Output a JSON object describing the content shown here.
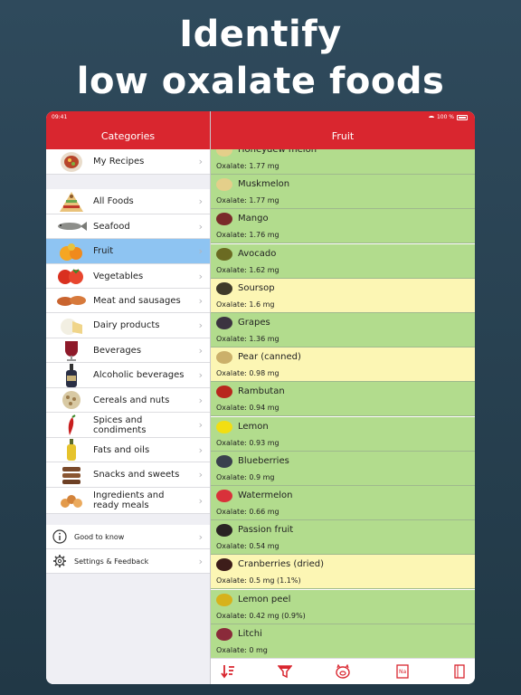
{
  "headline": {
    "line1": "Identify",
    "line2": "low oxalate foods"
  },
  "status_bar": {
    "time": "09:41",
    "battery": "100 %"
  },
  "left_header": {
    "title": "Categories"
  },
  "right_header": {
    "title": "Fruit"
  },
  "categories": [
    {
      "label": "My Recipes",
      "icon": "recipe-bowl-icon"
    },
    {
      "label": "All Foods",
      "icon": "food-pyramid-icon"
    },
    {
      "label": "Seafood",
      "icon": "fish-icon"
    },
    {
      "label": "Fruit",
      "icon": "fruit-icon",
      "selected": true
    },
    {
      "label": "Vegetables",
      "icon": "tomato-icon"
    },
    {
      "label": "Meat and sausages",
      "icon": "sausage-icon"
    },
    {
      "label": "Dairy products",
      "icon": "cheese-icon"
    },
    {
      "label": "Beverages",
      "icon": "wine-glass-icon"
    },
    {
      "label": "Alcoholic beverages",
      "icon": "bottle-icon"
    },
    {
      "label": "Cereals and nuts",
      "icon": "grain-icon"
    },
    {
      "label": "Spices and condiments",
      "icon": "chili-icon"
    },
    {
      "label": "Fats and oils",
      "icon": "oil-bottle-icon"
    },
    {
      "label": "Snacks and sweets",
      "icon": "cookie-icon"
    },
    {
      "label": "Ingredients and ready meals",
      "label_line1": "Ingredients and",
      "label_line2": "ready meals",
      "icon": "ingredients-icon"
    }
  ],
  "extras": [
    {
      "label": "Good to know",
      "icon": "info-icon"
    },
    {
      "label": "Settings & Feedback",
      "icon": "gear-icon"
    }
  ],
  "foods": [
    {
      "name": "Honeydew melon",
      "oxalate": "Oxalate: 1.77 mg",
      "color": "green",
      "icon": "melon-icon"
    },
    {
      "name": "Muskmelon",
      "oxalate": "Oxalate: 1.77 mg",
      "color": "green",
      "icon": "melon-icon"
    },
    {
      "name": "Mango",
      "oxalate": "Oxalate: 1.76 mg",
      "color": "green",
      "icon": "mango-icon"
    },
    {
      "name": "Avocado",
      "oxalate": "Oxalate: 1.62 mg",
      "color": "green",
      "icon": "avocado-icon"
    },
    {
      "name": "Soursop",
      "oxalate": "Oxalate: 1.6 mg",
      "color": "yellow",
      "icon": "soursop-icon"
    },
    {
      "name": "Grapes",
      "oxalate": "Oxalate: 1.36 mg",
      "color": "green",
      "icon": "grapes-icon"
    },
    {
      "name": "Pear (canned)",
      "oxalate": "Oxalate: 0.98 mg",
      "color": "yellow",
      "icon": "pear-icon"
    },
    {
      "name": "Rambutan",
      "oxalate": "Oxalate: 0.94 mg",
      "color": "green",
      "icon": "rambutan-icon"
    },
    {
      "name": "Lemon",
      "oxalate": "Oxalate: 0.93 mg",
      "color": "green",
      "icon": "lemon-icon"
    },
    {
      "name": "Blueberries",
      "oxalate": "Oxalate: 0.9 mg",
      "color": "green",
      "icon": "blueberries-icon"
    },
    {
      "name": "Watermelon",
      "oxalate": "Oxalate: 0.66 mg",
      "color": "green",
      "icon": "watermelon-icon"
    },
    {
      "name": "Passion fruit",
      "oxalate": "Oxalate: 0.54 mg",
      "color": "green",
      "icon": "passion-fruit-icon"
    },
    {
      "name": "Cranberries (dried)",
      "oxalate": "Oxalate: 0.5 mg (1.1%)",
      "color": "yellow",
      "icon": "cranberries-icon"
    },
    {
      "name": "Lemon peel",
      "oxalate": "Oxalate: 0.42 mg (0.9%)",
      "color": "green",
      "icon": "lemon-peel-icon"
    },
    {
      "name": "Litchi",
      "oxalate": "Oxalate: 0 mg",
      "color": "green",
      "icon": "litchi-icon"
    }
  ],
  "tabs": [
    {
      "icon": "sort-icon"
    },
    {
      "icon": "filter-icon"
    },
    {
      "icon": "pig-icon"
    },
    {
      "icon": "nutrition-label-icon"
    },
    {
      "icon": "notebook-icon"
    }
  ],
  "colors": {
    "header_red": "#d9262f",
    "row_green": "#b2dc8d",
    "row_yellow": "#fcf6b4",
    "selected_blue": "#8ec4f2",
    "background": "#2a4353"
  }
}
